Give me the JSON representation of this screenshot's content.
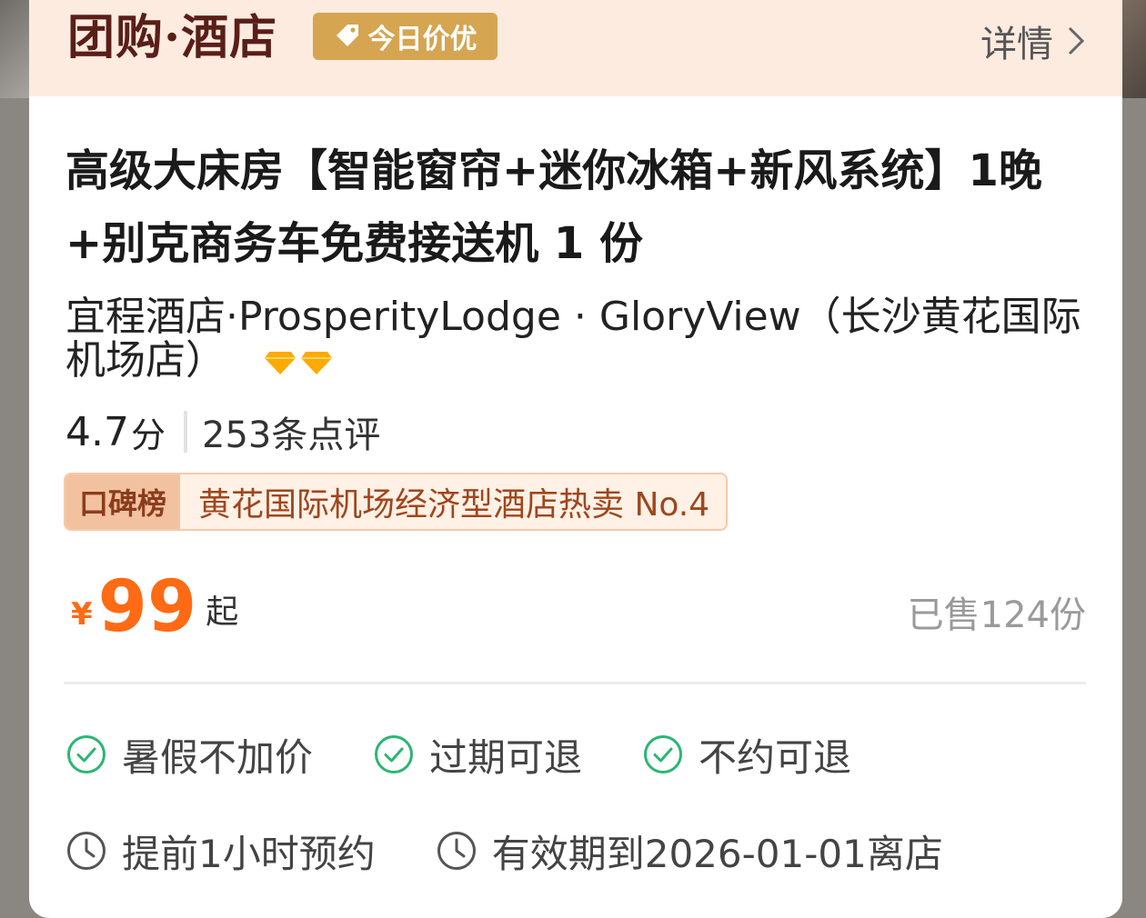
{
  "header": {
    "brand": "团购·酒店",
    "deal_badge": "今日价优",
    "detail_link": "详情"
  },
  "product": {
    "title": "高级大床房【智能窗帘+迷你冰箱+新风系统】1晚+别克商务车免费接送机 1 份",
    "hotel_name": "宜程酒店·ProsperityLodge · GloryView（长沙黄花国际机场店）",
    "diamond_count": 2,
    "score": "4.7",
    "score_unit": "分",
    "reviews": "253条点评",
    "rank_badge": {
      "label": "口碑榜",
      "text": "黄花国际机场经济型酒店热卖 No.4"
    },
    "price": {
      "currency": "¥",
      "amount": "99",
      "suffix": "起"
    },
    "sold": "已售124份"
  },
  "features": [
    {
      "icon": "check-circle-icon",
      "label": "暑假不加价"
    },
    {
      "icon": "check-circle-icon",
      "label": "过期可退"
    },
    {
      "icon": "check-circle-icon",
      "label": "不约可退"
    }
  ],
  "info": [
    {
      "icon": "clock-icon",
      "label": "提前1小时预约"
    },
    {
      "icon": "clock-icon",
      "label": "有效期到2026-01-01离店"
    }
  ],
  "colors": {
    "header_bg": "#fdebe0",
    "brand": "#5a1e18",
    "deal_badge": "#d5a551",
    "price": "#ff6a14",
    "check": "#2bb673",
    "diamond": "#ffaa00"
  }
}
